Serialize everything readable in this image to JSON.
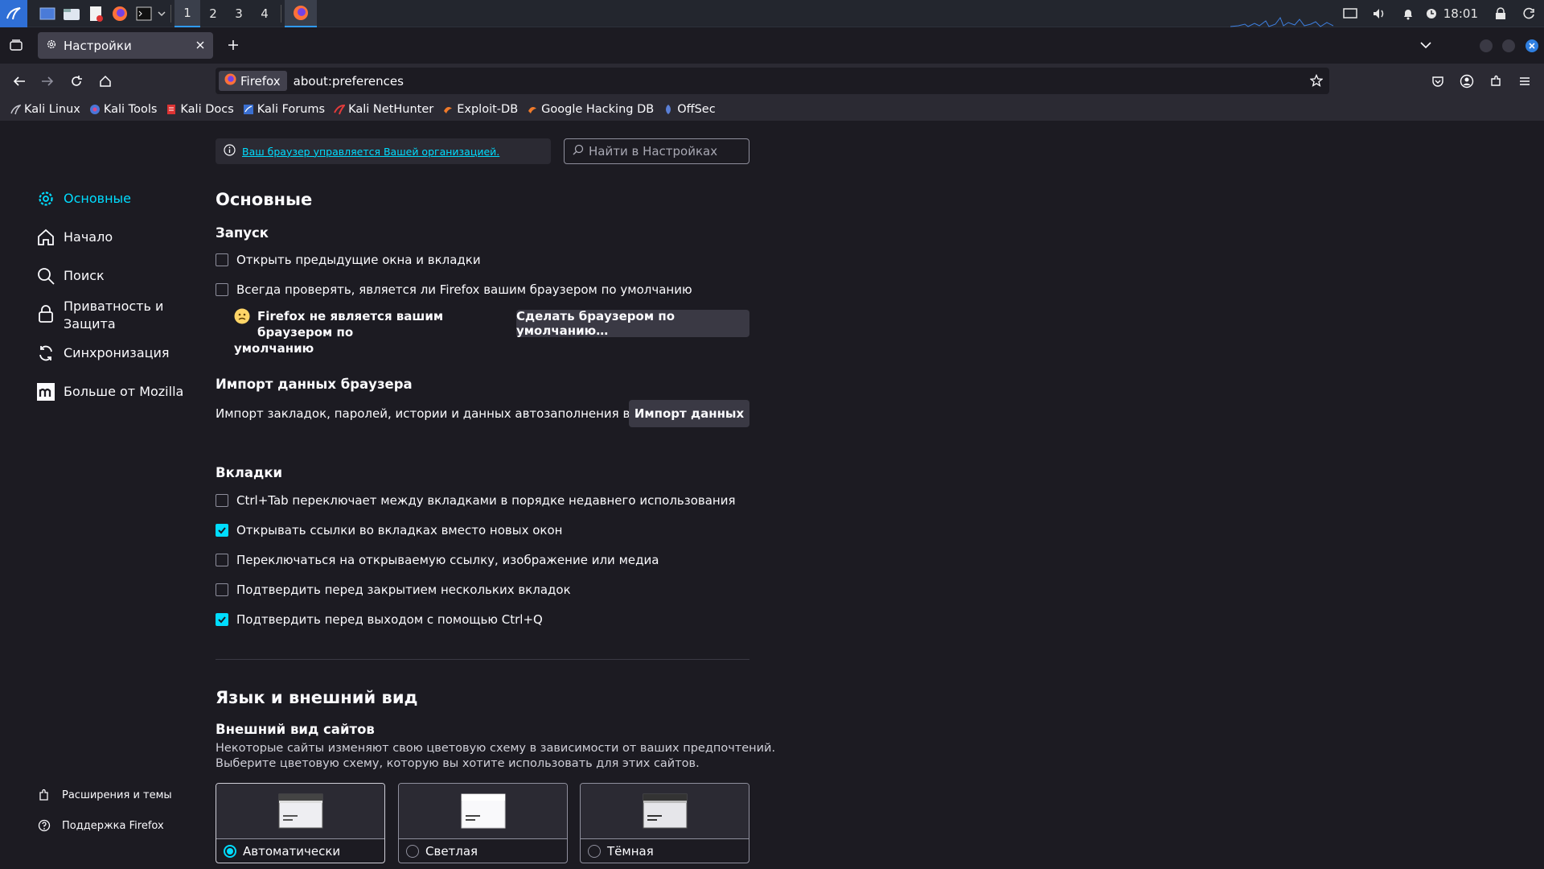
{
  "taskbar": {
    "workspaces": [
      "1",
      "2",
      "3",
      "4"
    ],
    "active_workspace": "1",
    "clock": "18:01"
  },
  "browser": {
    "tab_title": "Настройки",
    "identity_label": "Firefox",
    "url": "about:preferences",
    "bookmarks": [
      "Kali Linux",
      "Kali Tools",
      "Kali Docs",
      "Kali Forums",
      "Kali NetHunter",
      "Exploit-DB",
      "Google Hacking DB",
      "OffSec"
    ]
  },
  "sidebar": {
    "items": [
      {
        "label": "Основные",
        "icon": "gear-icon"
      },
      {
        "label": "Начало",
        "icon": "home-icon"
      },
      {
        "label": "Поиск",
        "icon": "search-icon"
      },
      {
        "label": "Приватность и Защита",
        "icon": "lock-icon"
      },
      {
        "label": "Синхронизация",
        "icon": "sync-icon"
      },
      {
        "label": "Больше от Mozilla",
        "icon": "mozilla-icon"
      }
    ],
    "footer": [
      {
        "label": "Расширения и темы",
        "icon": "puzzle-icon"
      },
      {
        "label": "Поддержка Firefox",
        "icon": "help-icon"
      }
    ]
  },
  "main": {
    "policy_notice": "Ваш браузер управляется Вашей организацией.",
    "search_placeholder": "Найти в Настройках",
    "title": "Основные",
    "startup": {
      "heading": "Запуск",
      "open_previous": "Открыть предыдущие окна и вкладки",
      "check_default": "Всегда проверять, является ли Firefox вашим браузером по умолчанию",
      "not_default_line1": "Firefox не является вашим браузером по",
      "not_default_line2": "умолчанию",
      "make_default_button": "Сделать браузером по умолчанию…"
    },
    "import": {
      "heading": "Импорт данных браузера",
      "description": "Импорт закладок, паролей, истории и данных автозаполнения в Firefox.",
      "button": "Импорт данных"
    },
    "tabs": {
      "heading": "Вкладки",
      "options": [
        {
          "label": "Ctrl+Tab переключает между вкладками в порядке недавнего использования",
          "checked": false
        },
        {
          "label": "Открывать ссылки во вкладках вместо новых окон",
          "checked": true
        },
        {
          "label": "Переключаться на открываемую ссылку, изображение или медиа",
          "checked": false
        },
        {
          "label": "Подтвердить перед закрытием нескольких вкладок",
          "checked": false
        },
        {
          "label": "Подтвердить перед выходом с помощью Ctrl+Q",
          "checked": true
        }
      ]
    },
    "appearance": {
      "heading": "Язык и внешний вид",
      "subheading": "Внешний вид сайтов",
      "desc_line1": "Некоторые сайты изменяют свою цветовую схему в зависимости от ваших предпочтений.",
      "desc_line2": "Выберите цветовую схему, которую вы хотите использовать для этих сайтов.",
      "themes": [
        {
          "label": "Автоматически",
          "selected": true
        },
        {
          "label": "Светлая",
          "selected": false
        },
        {
          "label": "Тёмная",
          "selected": false
        }
      ]
    }
  },
  "colors": {
    "accent": "#00ddff",
    "background": "#1c1b22",
    "toolbar": "#2b2a33"
  }
}
